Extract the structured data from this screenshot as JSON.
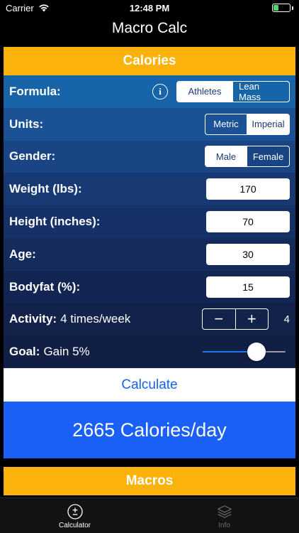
{
  "status_bar": {
    "carrier": "Carrier",
    "time": "12:48 PM"
  },
  "nav": {
    "title": "Macro Calc"
  },
  "calories": {
    "header": "Calories",
    "formula": {
      "label": "Formula:",
      "options": [
        "Athletes",
        "Lean Mass"
      ],
      "selected": "Athletes"
    },
    "units": {
      "label": "Units:",
      "options": [
        "Metric",
        "Imperial"
      ],
      "selected": "Imperial"
    },
    "gender": {
      "label": "Gender:",
      "options": [
        "Male",
        "Female"
      ],
      "selected": "Male"
    },
    "weight": {
      "label": "Weight (lbs):",
      "value": "170"
    },
    "height": {
      "label": "Height (inches):",
      "value": "70"
    },
    "age": {
      "label": "Age:",
      "value": "30"
    },
    "bodyfat": {
      "label": "Bodyfat (%):",
      "value": "15"
    },
    "activity": {
      "label": "Activity:",
      "text": "4 times/week",
      "minus": "−",
      "plus": "+",
      "value": "4"
    },
    "goal": {
      "label": "Goal:",
      "text": "Gain 5%",
      "slider_fraction": 0.65
    },
    "calculate_label": "Calculate",
    "result": "2665 Calories/day"
  },
  "macros": {
    "header": "Macros"
  },
  "tabs": [
    {
      "label": "Calculator",
      "icon": "plus-minus-icon",
      "active": true
    },
    {
      "label": "Info",
      "icon": "layers-icon",
      "active": false
    }
  ],
  "colors": {
    "accent": "#fbb30c",
    "result_bg": "#1a5ff6",
    "button_text": "#1563e6",
    "row_gradient": [
      "#1764a8",
      "#1b5296",
      "#1a4585",
      "#183a74",
      "#163167",
      "#142b5b",
      "#132653",
      "#12224b",
      "#111f45",
      "#101c3f"
    ]
  }
}
